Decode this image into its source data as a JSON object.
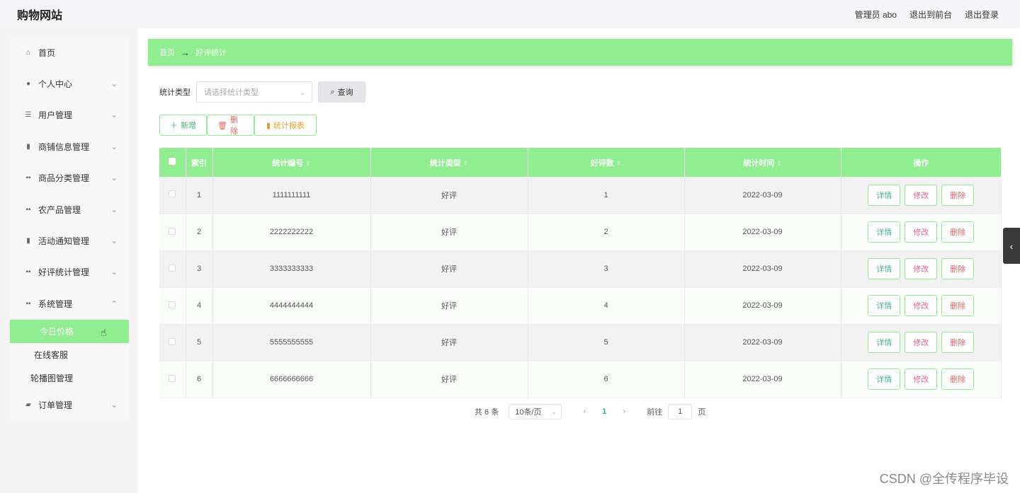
{
  "header": {
    "brand": "购物网站",
    "admin": "管理员 abo",
    "to_front": "退出到前台",
    "logout": "退出登录"
  },
  "sidebar": {
    "items": [
      {
        "label": "首页",
        "icon": "home-icon"
      },
      {
        "label": "个人中心",
        "icon": "user-icon"
      },
      {
        "label": "用户管理",
        "icon": "list-icon"
      },
      {
        "label": "商铺信息管理",
        "icon": "clipboard-icon"
      },
      {
        "label": "商品分类管理",
        "icon": "grid-icon"
      },
      {
        "label": "农产品管理",
        "icon": "grid-icon"
      },
      {
        "label": "活动通知管理",
        "icon": "clipboard-icon"
      },
      {
        "label": "好评统计管理",
        "icon": "grid-icon"
      },
      {
        "label": "系统管理",
        "icon": "grid-icon"
      }
    ],
    "sub_items": [
      "今日价格",
      "在线客服",
      "轮播图管理"
    ],
    "last_item": {
      "label": "订单管理",
      "icon": "thumb-icon"
    }
  },
  "breadcrumb": {
    "home": "首页",
    "current": "好评统计"
  },
  "filter": {
    "label": "统计类型",
    "placeholder": "请选择统计类型",
    "query_button": "查询"
  },
  "actions": {
    "add": "新增",
    "delete": "删除",
    "report": "统计报表"
  },
  "table": {
    "headers": [
      "索引",
      "统计编号",
      "统计类型",
      "好评数",
      "统计时间",
      "操作"
    ],
    "rows": [
      {
        "index": "1",
        "code": "1111111111",
        "type": "好评",
        "count": "1",
        "date": "2022-03-09"
      },
      {
        "index": "2",
        "code": "2222222222",
        "type": "好评",
        "count": "2",
        "date": "2022-03-09"
      },
      {
        "index": "3",
        "code": "3333333333",
        "type": "好评",
        "count": "3",
        "date": "2022-03-09"
      },
      {
        "index": "4",
        "code": "4444444444",
        "type": "好评",
        "count": "4",
        "date": "2022-03-09"
      },
      {
        "index": "5",
        "code": "5555555555",
        "type": "好评",
        "count": "5",
        "date": "2022-03-09"
      },
      {
        "index": "6",
        "code": "6666666666",
        "type": "好评",
        "count": "6",
        "date": "2022-03-09"
      }
    ],
    "op_detail": "详情",
    "op_edit": "修改",
    "op_delete": "删除"
  },
  "pager": {
    "total": "共 6 条",
    "page_size": "10条/页",
    "current_page": "1",
    "goto_prefix": "前往",
    "goto_value": "1",
    "goto_suffix": "页"
  },
  "watermark": "CSDN @全传程序毕设",
  "colors": {
    "accent": "#90ee90",
    "topbar": "#f5f5f7"
  }
}
